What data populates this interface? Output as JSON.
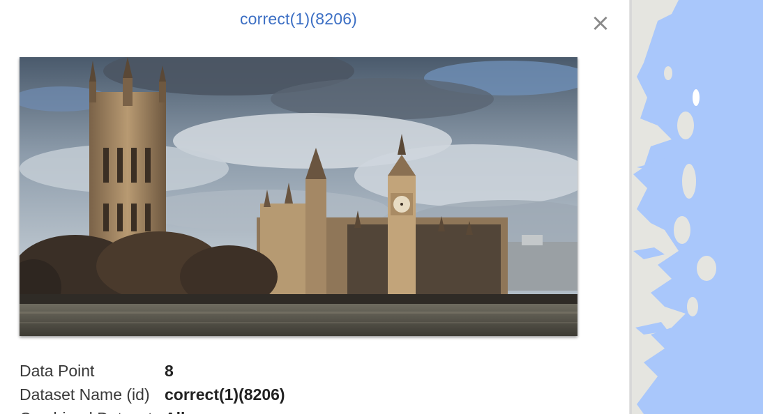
{
  "modal": {
    "title": "correct(1)(8206)",
    "close_icon": "close-icon",
    "close_glyph": "×"
  },
  "photo": {
    "subject": "Palace of Westminster and Big Ben beside the River Thames under a cloudy sky"
  },
  "details": [
    {
      "label": "Data Point",
      "value": "8"
    },
    {
      "label": "Dataset Name (id)",
      "value": "correct(1)(8206)"
    },
    {
      "label": "Combined Dataset",
      "value": "All"
    }
  ],
  "colors": {
    "title": "#3c6fc4",
    "water": "#a9c7fb",
    "land": "#e5e5e0",
    "close": "#8a8a8a"
  }
}
